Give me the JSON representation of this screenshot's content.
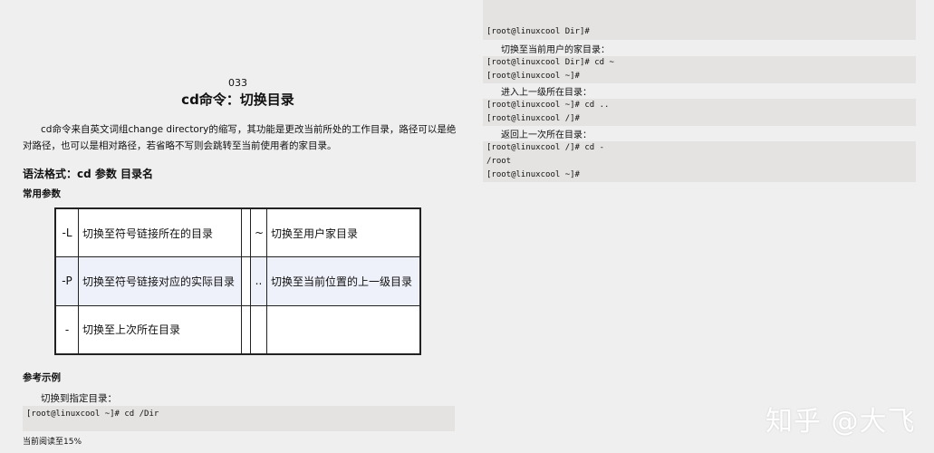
{
  "left_page": {
    "page_number": "033",
    "title": "cd命令：切换目录",
    "intro": "cd命令来自英文词组change directory的缩写，其功能是更改当前所处的工作目录，路径可以是绝对路径，也可以是相对路径，若省略不写则会跳转至当前使用者的家目录。",
    "syntax": "语法格式：cd 参数 目录名",
    "params_label": "常用参数",
    "params": [
      {
        "left_flag": "-L",
        "left_desc": "切换至符号链接所在的目录",
        "right_flag": "~",
        "right_desc": "切换至用户家目录"
      },
      {
        "left_flag": "-P",
        "left_desc": "切换至符号链接对应的实际目录",
        "right_flag": "..",
        "right_desc": "切换至当前位置的上一级目录"
      },
      {
        "left_flag": "-",
        "left_desc": "切换至上次所在目录",
        "right_flag": "",
        "right_desc": ""
      }
    ],
    "example_label": "参考示例",
    "example_desc": "切换到指定目录：",
    "example_code": "[root@linuxcool ~]# cd /Dir",
    "reading_progress": "当前阅读至15%"
  },
  "right_page": {
    "examples": [
      {
        "lines": [
          "[root@linuxcool Dir]#"
        ]
      },
      {
        "desc": "切换至当前用户的家目录：",
        "lines": [
          "[root@linuxcool Dir]# cd ~",
          "[root@linuxcool ~]#"
        ]
      },
      {
        "desc": "进入上一级所在目录：",
        "lines": [
          "[root@linuxcool ~]# cd ..",
          "[root@linuxcool /]#"
        ]
      },
      {
        "desc": "返回上一次所在目录：",
        "lines": [
          "[root@linuxcool /]# cd -",
          "/root",
          "[root@linuxcool ~]#"
        ]
      }
    ]
  },
  "watermark": "知乎 @大飞"
}
